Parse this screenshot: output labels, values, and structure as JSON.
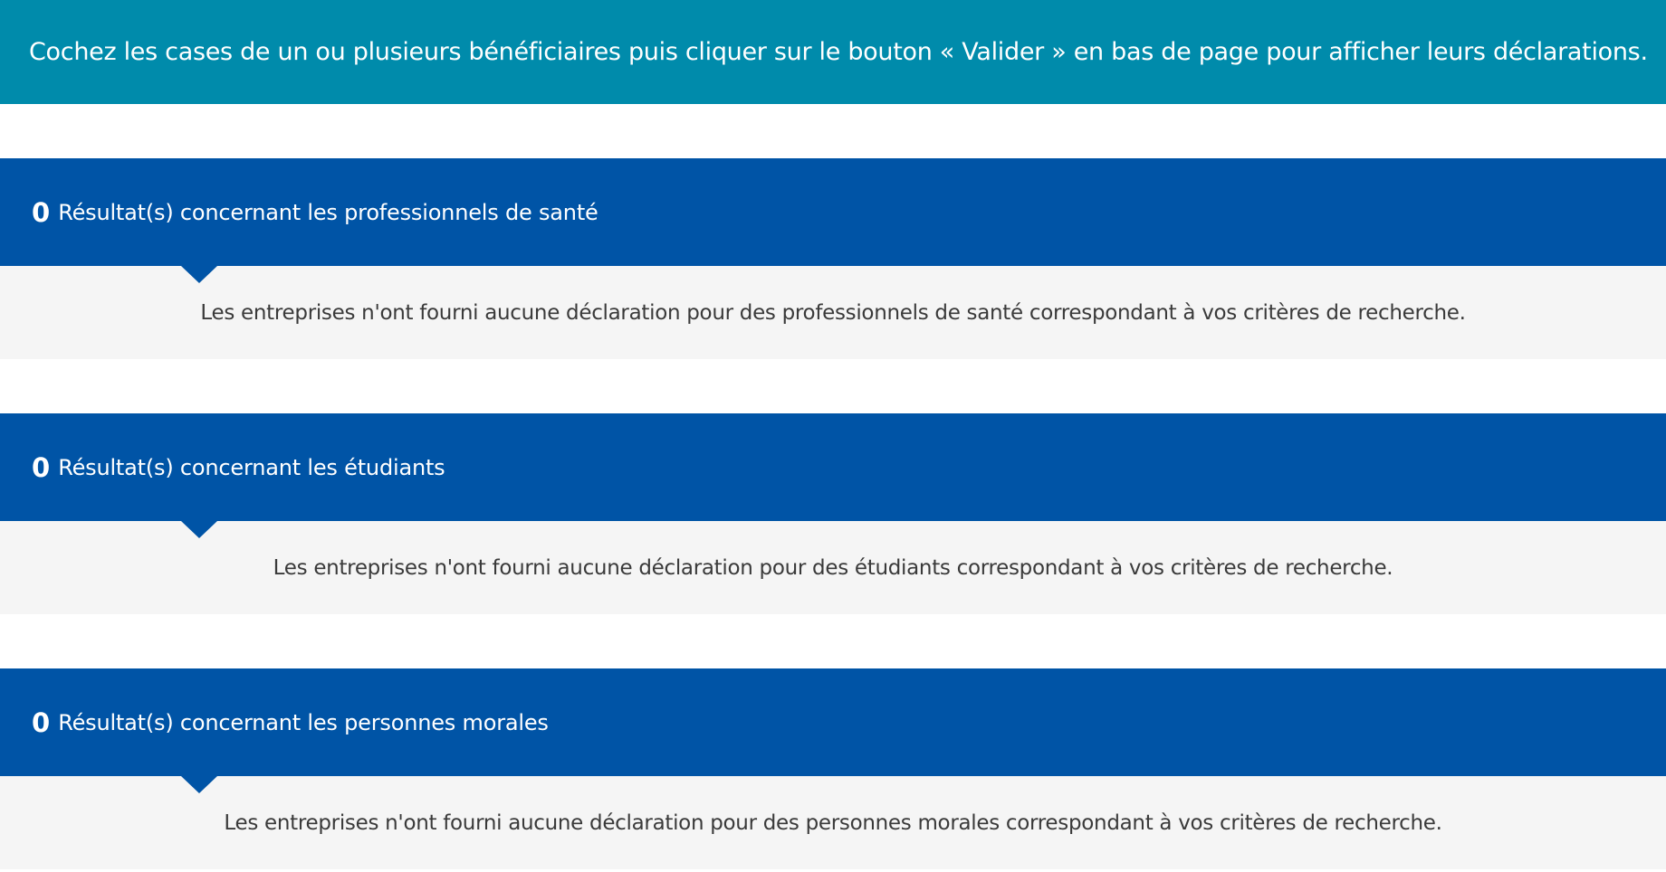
{
  "colors": {
    "banner": "#008bab",
    "section_header": "#0054a6",
    "section_body": "#f5f5f5"
  },
  "banner": {
    "text": "Cochez les cases de un ou plusieurs bénéficiaires puis cliquer sur le bouton « Valider » en bas de page pour afficher leurs déclarations."
  },
  "sections": [
    {
      "count": "0",
      "title": "Résultat(s) concernant les professionnels de santé",
      "message": "Les entreprises n'ont fourni aucune déclaration pour des professionnels de santé correspondant à vos critères de recherche."
    },
    {
      "count": "0",
      "title": "Résultat(s) concernant les étudiants",
      "message": "Les entreprises n'ont fourni aucune déclaration pour des étudiants correspondant à vos critères de recherche."
    },
    {
      "count": "0",
      "title": "Résultat(s) concernant les personnes morales",
      "message": "Les entreprises n'ont fourni aucune déclaration pour des personnes morales correspondant à vos critères de recherche."
    }
  ]
}
